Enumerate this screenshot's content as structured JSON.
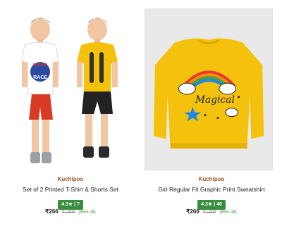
{
  "products": [
    {
      "brand": "Kuchipoo",
      "title": "Set of 2 Printed T-Shirt & Shorts Set",
      "rating": "4.3★ | 7",
      "price": "₹266",
      "mrp": "₹1,899",
      "discount": "(85% off)"
    },
    {
      "brand": "Kuchipoo",
      "title": "Girl Regular Fit Graphic Print Sweatshirt",
      "rating": "4.3★ | 46",
      "price": "₹266",
      "mrp": "₹1,899",
      "discount": "(85% off)"
    }
  ],
  "colors": {
    "brand": "#9c5a2c",
    "rating_badge": "#388e3c",
    "shirt_yellow": "#f4c20d",
    "shorts_red": "#d93a25",
    "shorts_black": "#222222"
  },
  "icons": [
    "product-photo-boys-tshirt-shorts",
    "product-photo-yellow-sweatshirt",
    "star-icon"
  ]
}
